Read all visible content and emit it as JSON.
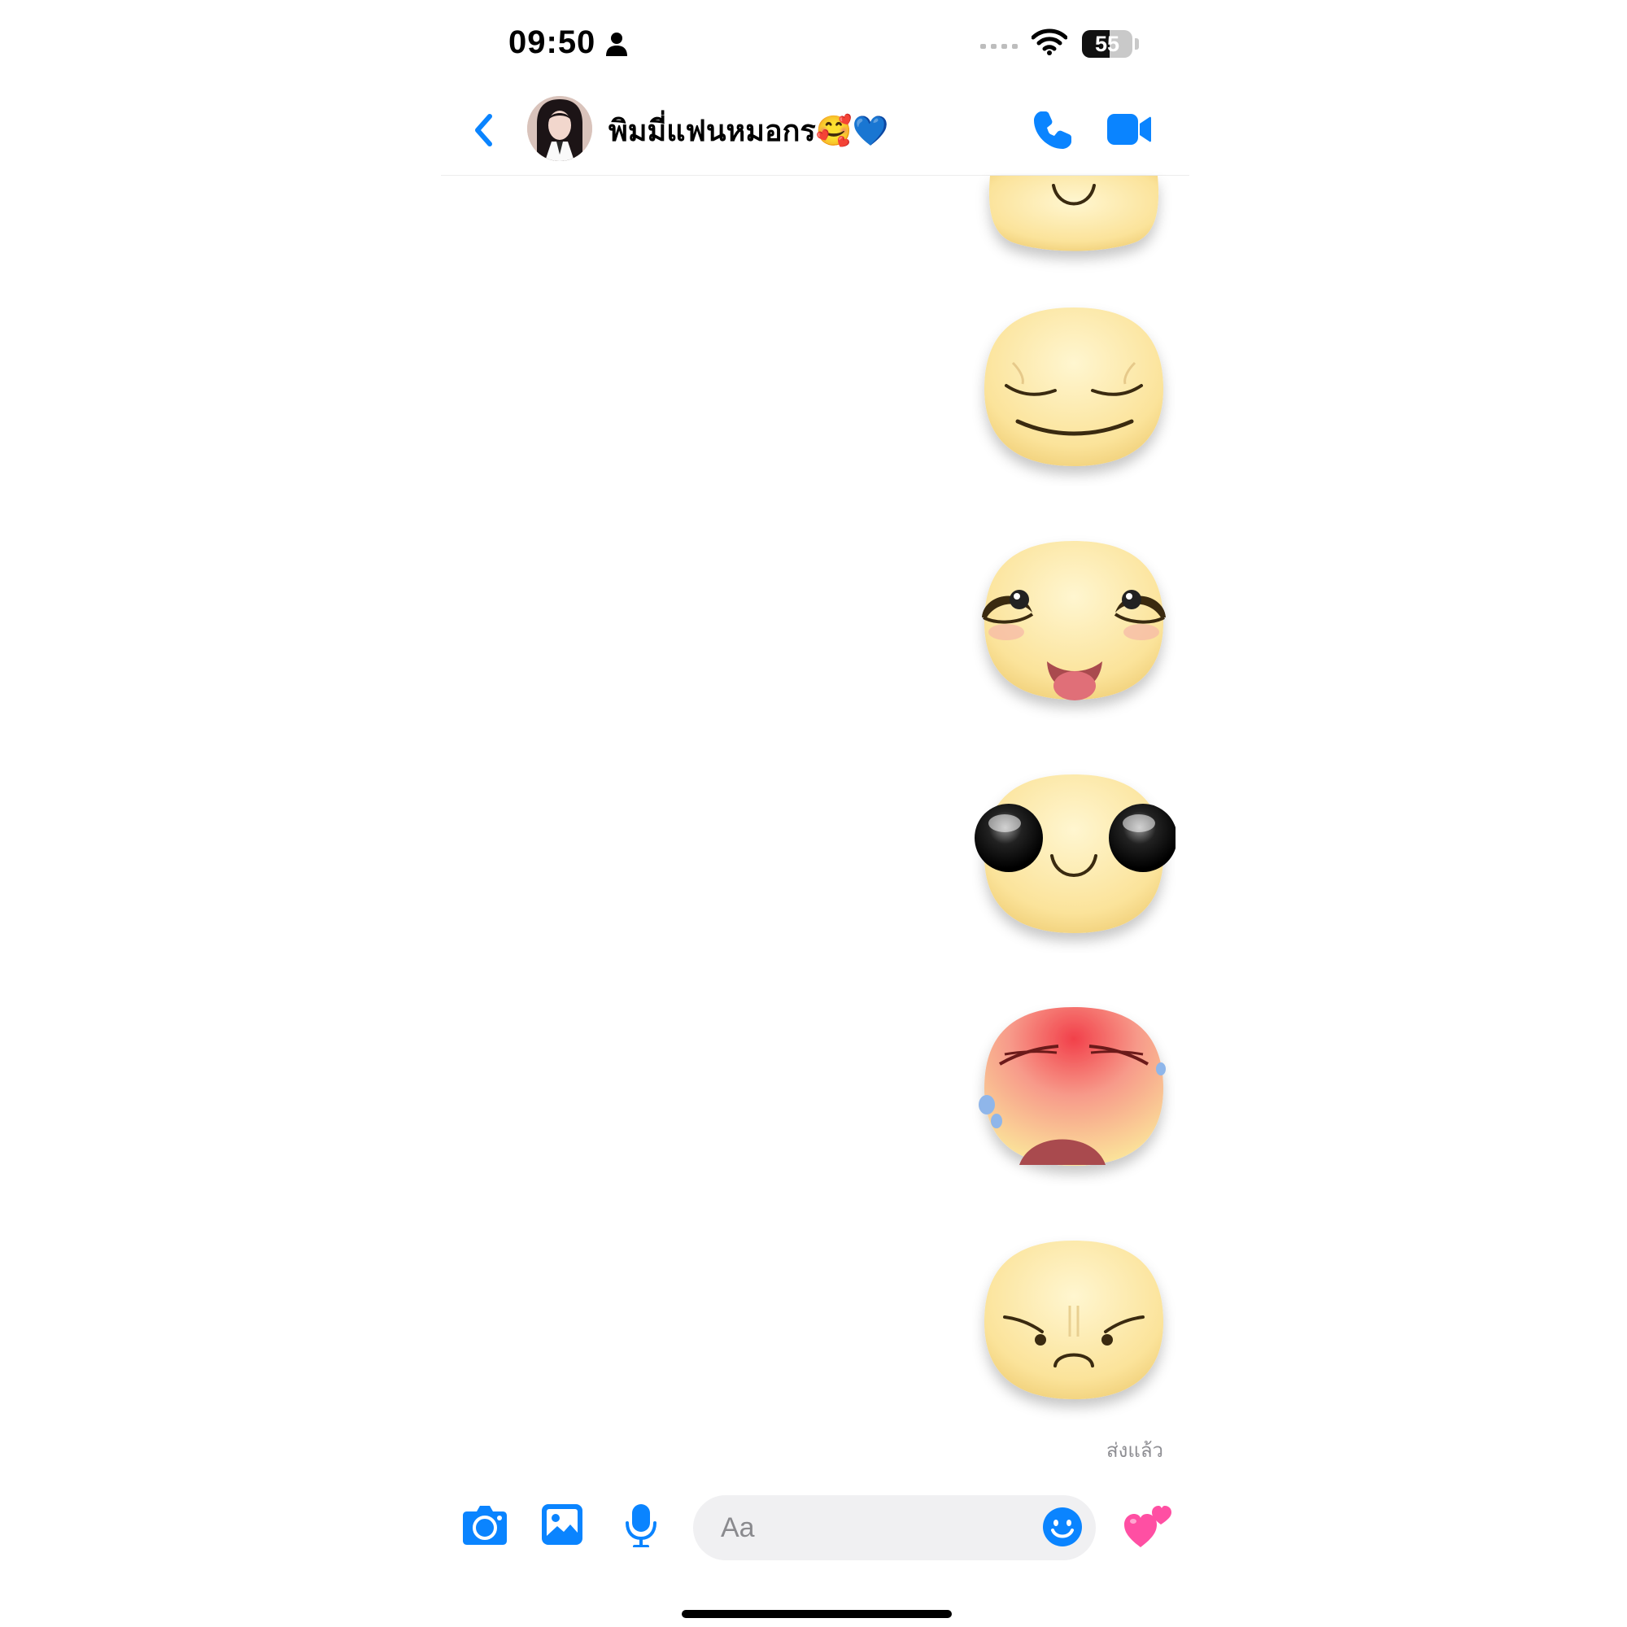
{
  "status_bar": {
    "time": "09:50",
    "battery_level": "55"
  },
  "header": {
    "contact_name": "พิมมี่แฟนหมอกร🥰💙"
  },
  "stickers": [
    {
      "name": "smiling-face-sticker"
    },
    {
      "name": "content-sleepy-face-sticker"
    },
    {
      "name": "blushing-tongue-face-sticker"
    },
    {
      "name": "big-glossy-eyes-face-sticker"
    },
    {
      "name": "red-sweating-face-sticker"
    },
    {
      "name": "worried-frowning-face-sticker"
    }
  ],
  "message_status": "ส่งแล้ว",
  "composer": {
    "placeholder": "Aa"
  },
  "colors": {
    "accent": "#0a84ff",
    "sticker_face": "#fbe7a5",
    "heart": "#ff4fa3"
  },
  "icons": [
    "person-icon",
    "signal-icon",
    "wifi-icon",
    "battery-icon",
    "back-chevron-icon",
    "phone-icon",
    "video-camera-icon",
    "camera-icon",
    "image-icon",
    "microphone-icon",
    "smiley-icon",
    "two-hearts-icon"
  ]
}
